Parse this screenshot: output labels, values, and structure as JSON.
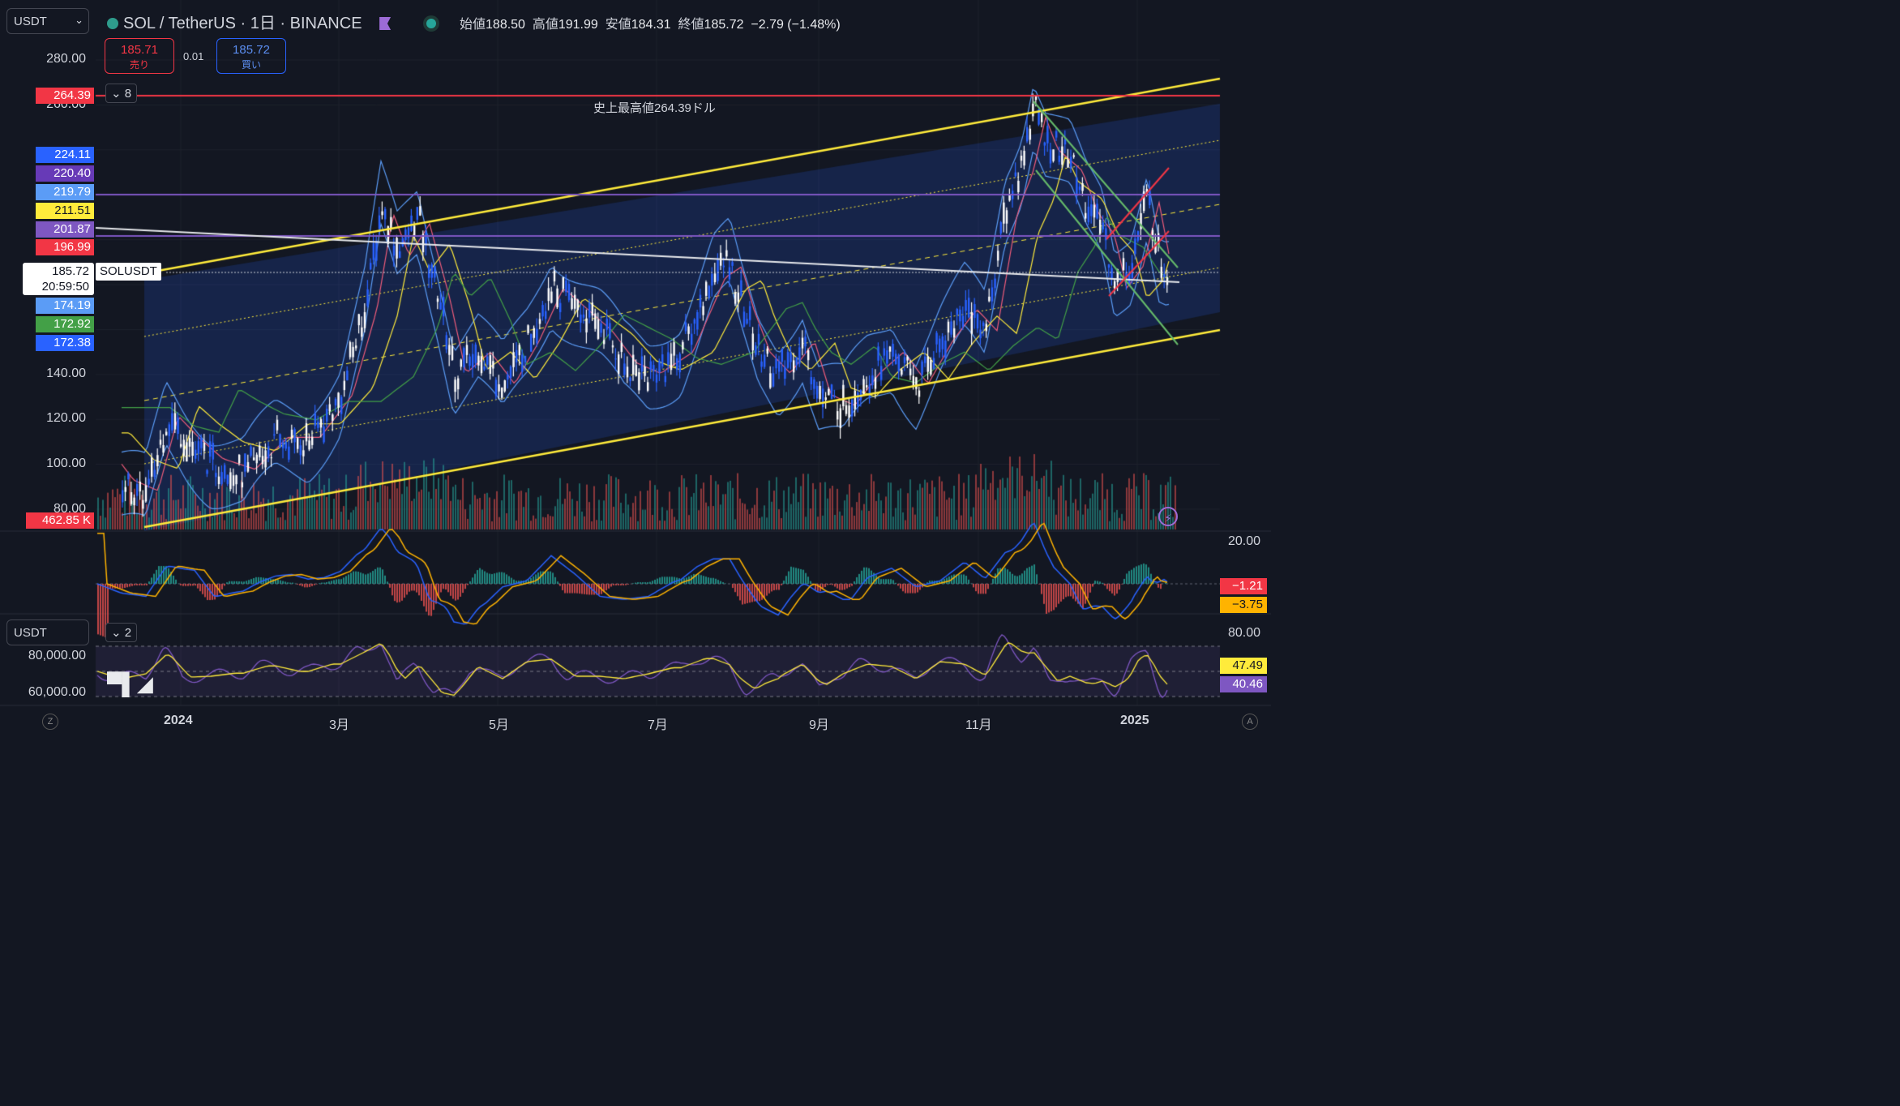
{
  "header": {
    "currency_select": "USDT",
    "symbol": "SOL / TetherUS",
    "interval": "1日",
    "exchange": "BINANCE",
    "title_line": "SOL / TetherUS · 1日 · BINANCE",
    "ohlc": {
      "open_label": "始値",
      "open": "188.50",
      "high_label": "高値",
      "high": "191.99",
      "low_label": "安値",
      "low": "184.31",
      "close_label": "終値",
      "close": "185.72",
      "change": "−2.79 (−1.48%)"
    }
  },
  "trade": {
    "sell_price": "185.71",
    "sell_label": "売り",
    "spread": "0.01",
    "buy_price": "185.72",
    "buy_label": "買い"
  },
  "indicators_collapse": {
    "count": "8"
  },
  "oscillator_collapse": {
    "count": "2"
  },
  "price_axis": [
    "280.00",
    "260.00",
    "140.00",
    "120.00",
    "100.00",
    "80.00"
  ],
  "price_tags": [
    {
      "value": "264.39",
      "color": "#f23645"
    },
    {
      "value": "224.11",
      "color": "#2962ff"
    },
    {
      "value": "220.40",
      "color": "#673ab7"
    },
    {
      "value": "219.79",
      "color": "#5b9cf6"
    },
    {
      "value": "211.51",
      "color": "#ffeb3b"
    },
    {
      "value": "201.87",
      "color": "#7e57c2"
    },
    {
      "value": "196.99",
      "color": "#f23645"
    },
    {
      "value": "174.19",
      "color": "#5b9cf6"
    },
    {
      "value": "172.92",
      "color": "#43a047"
    },
    {
      "value": "172.38",
      "color": "#2962ff"
    }
  ],
  "current_price": {
    "symbol_tag": "SOLUSDT",
    "price": "185.72",
    "countdown": "20:59:50"
  },
  "volume_tag": "462.85 K",
  "ath_label": "史上最高値264.39ドル",
  "macd_axis": {
    "top": "20.00",
    "tag1": "−1.21",
    "tag2": "−3.75"
  },
  "rsi_panel": {
    "currency_select": "USDT",
    "axis_top": "80.00",
    "left_axis": [
      "80,000.00",
      "60,000.00"
    ],
    "tag1": "47.49",
    "tag2": "40.46"
  },
  "time_axis": [
    "2024",
    "3月",
    "5月",
    "7月",
    "9月",
    "11月",
    "2025"
  ],
  "corner_buttons": {
    "left": "Z",
    "right": "A"
  },
  "chart_data": {
    "type": "candlestick",
    "title": "SOL / TetherUS · 1日 · BINANCE",
    "ylim": [
      80,
      285
    ],
    "ath": 264.39,
    "horizontal_levels": [
      264.39,
      220.4,
      201.87
    ],
    "series_description_values": {
      "dates": [
        "2023-12",
        "2024-01",
        "2024-02",
        "2024-03",
        "2024-04",
        "2024-05",
        "2024-06",
        "2024-07",
        "2024-08",
        "2024-09",
        "2024-10",
        "2024-11",
        "2024-12",
        "2025-01"
      ],
      "close": [
        105,
        95,
        110,
        200,
        150,
        165,
        150,
        180,
        140,
        135,
        160,
        240,
        195,
        185.72
      ]
    },
    "last": {
      "open": 188.5,
      "high": 191.99,
      "low": 184.31,
      "close": 185.72,
      "change": -2.79,
      "change_pct": -1.48
    }
  },
  "colors": {
    "background": "#131722",
    "up": "#2962ff",
    "down": "#ffffff",
    "ath_line": "#f23645",
    "channel": "#ffeb3b",
    "level_purple": "#7e57c2"
  }
}
